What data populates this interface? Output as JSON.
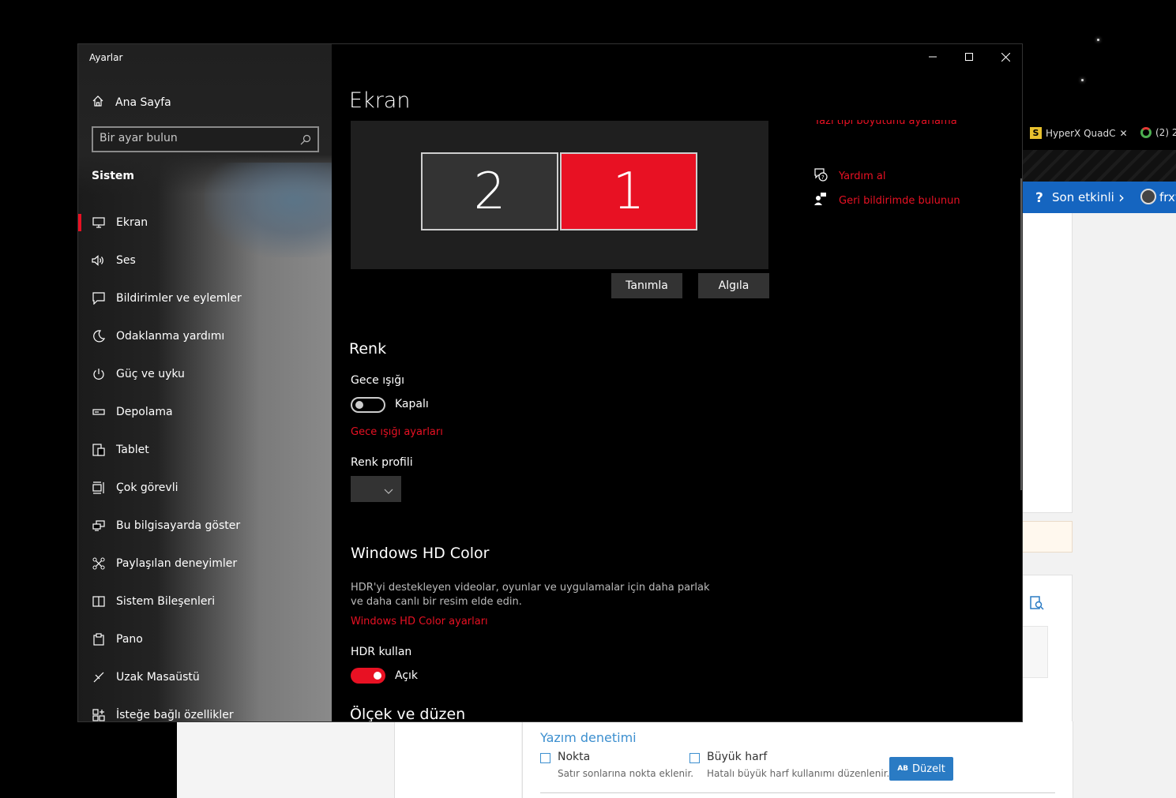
{
  "window": {
    "app_title": "Ayarlar"
  },
  "sidebar": {
    "home": "Ana Sayfa",
    "search_placeholder": "Bir ayar bulun",
    "section": "Sistem",
    "items": [
      {
        "label": "Ekran",
        "icon": "monitor-icon",
        "active": true
      },
      {
        "label": "Ses",
        "icon": "speaker-icon"
      },
      {
        "label": "Bildirimler ve eylemler",
        "icon": "notification-icon"
      },
      {
        "label": "Odaklanma yardımı",
        "icon": "moon-icon"
      },
      {
        "label": "Güç ve uyku",
        "icon": "power-icon"
      },
      {
        "label": "Depolama",
        "icon": "storage-icon"
      },
      {
        "label": "Tablet",
        "icon": "tablet-icon"
      },
      {
        "label": "Çok görevli",
        "icon": "multitask-icon"
      },
      {
        "label": "Bu bilgisayarda göster",
        "icon": "project-icon"
      },
      {
        "label": "Paylaşılan deneyimler",
        "icon": "shared-icon"
      },
      {
        "label": "Sistem Bileşenleri",
        "icon": "components-icon"
      },
      {
        "label": "Pano",
        "icon": "clipboard-icon"
      },
      {
        "label": "Uzak Masaüstü",
        "icon": "remote-icon"
      },
      {
        "label": "İsteğe bağlı özellikler",
        "icon": "features-icon"
      }
    ]
  },
  "main": {
    "title": "Ekran",
    "monitors": [
      "2",
      "1"
    ],
    "identify_button": "Tanımla",
    "detect_button": "Algıla",
    "color_heading": "Renk",
    "night_light_label": "Gece ışığı",
    "night_light_state": "Kapalı",
    "night_light_link": "Gece ışığı ayarları",
    "color_profile_label": "Renk profili",
    "hd_color_heading": "Windows HD Color",
    "hd_color_desc": "HDR'yi destekleyen videolar, oyunlar ve uygulamalar için daha parlak ve daha canlı bir resim elde edin.",
    "hd_color_link": "Windows HD Color ayarları",
    "hdr_label": "HDR kullan",
    "hdr_state": "Açık",
    "scale_heading": "Ölçek ve düzen"
  },
  "related": {
    "font_size_link": "Yazı tipi boyutunu ayarlama",
    "help_link": "Yardım al",
    "feedback_link": "Geri bildirimde bulunun"
  },
  "browser": {
    "tab1": "HyperX QuadC",
    "tab2": "(2) 2",
    "nav_text": "Son etkinli",
    "user_text": "frxv"
  },
  "web_panel": {
    "heading": "Yazım denetimi",
    "option1_label": "Nokta",
    "option1_desc": "Satır sonlarına nokta eklenir.",
    "option2_label": "Büyük harf",
    "option2_desc": "Hatalı büyük harf kullanımı düzenlenir.",
    "fix_button": "Düzelt",
    "fix_icon_text": "AB"
  },
  "colors": {
    "accent": "#e81123",
    "link_blue": "#3c8fcf"
  }
}
